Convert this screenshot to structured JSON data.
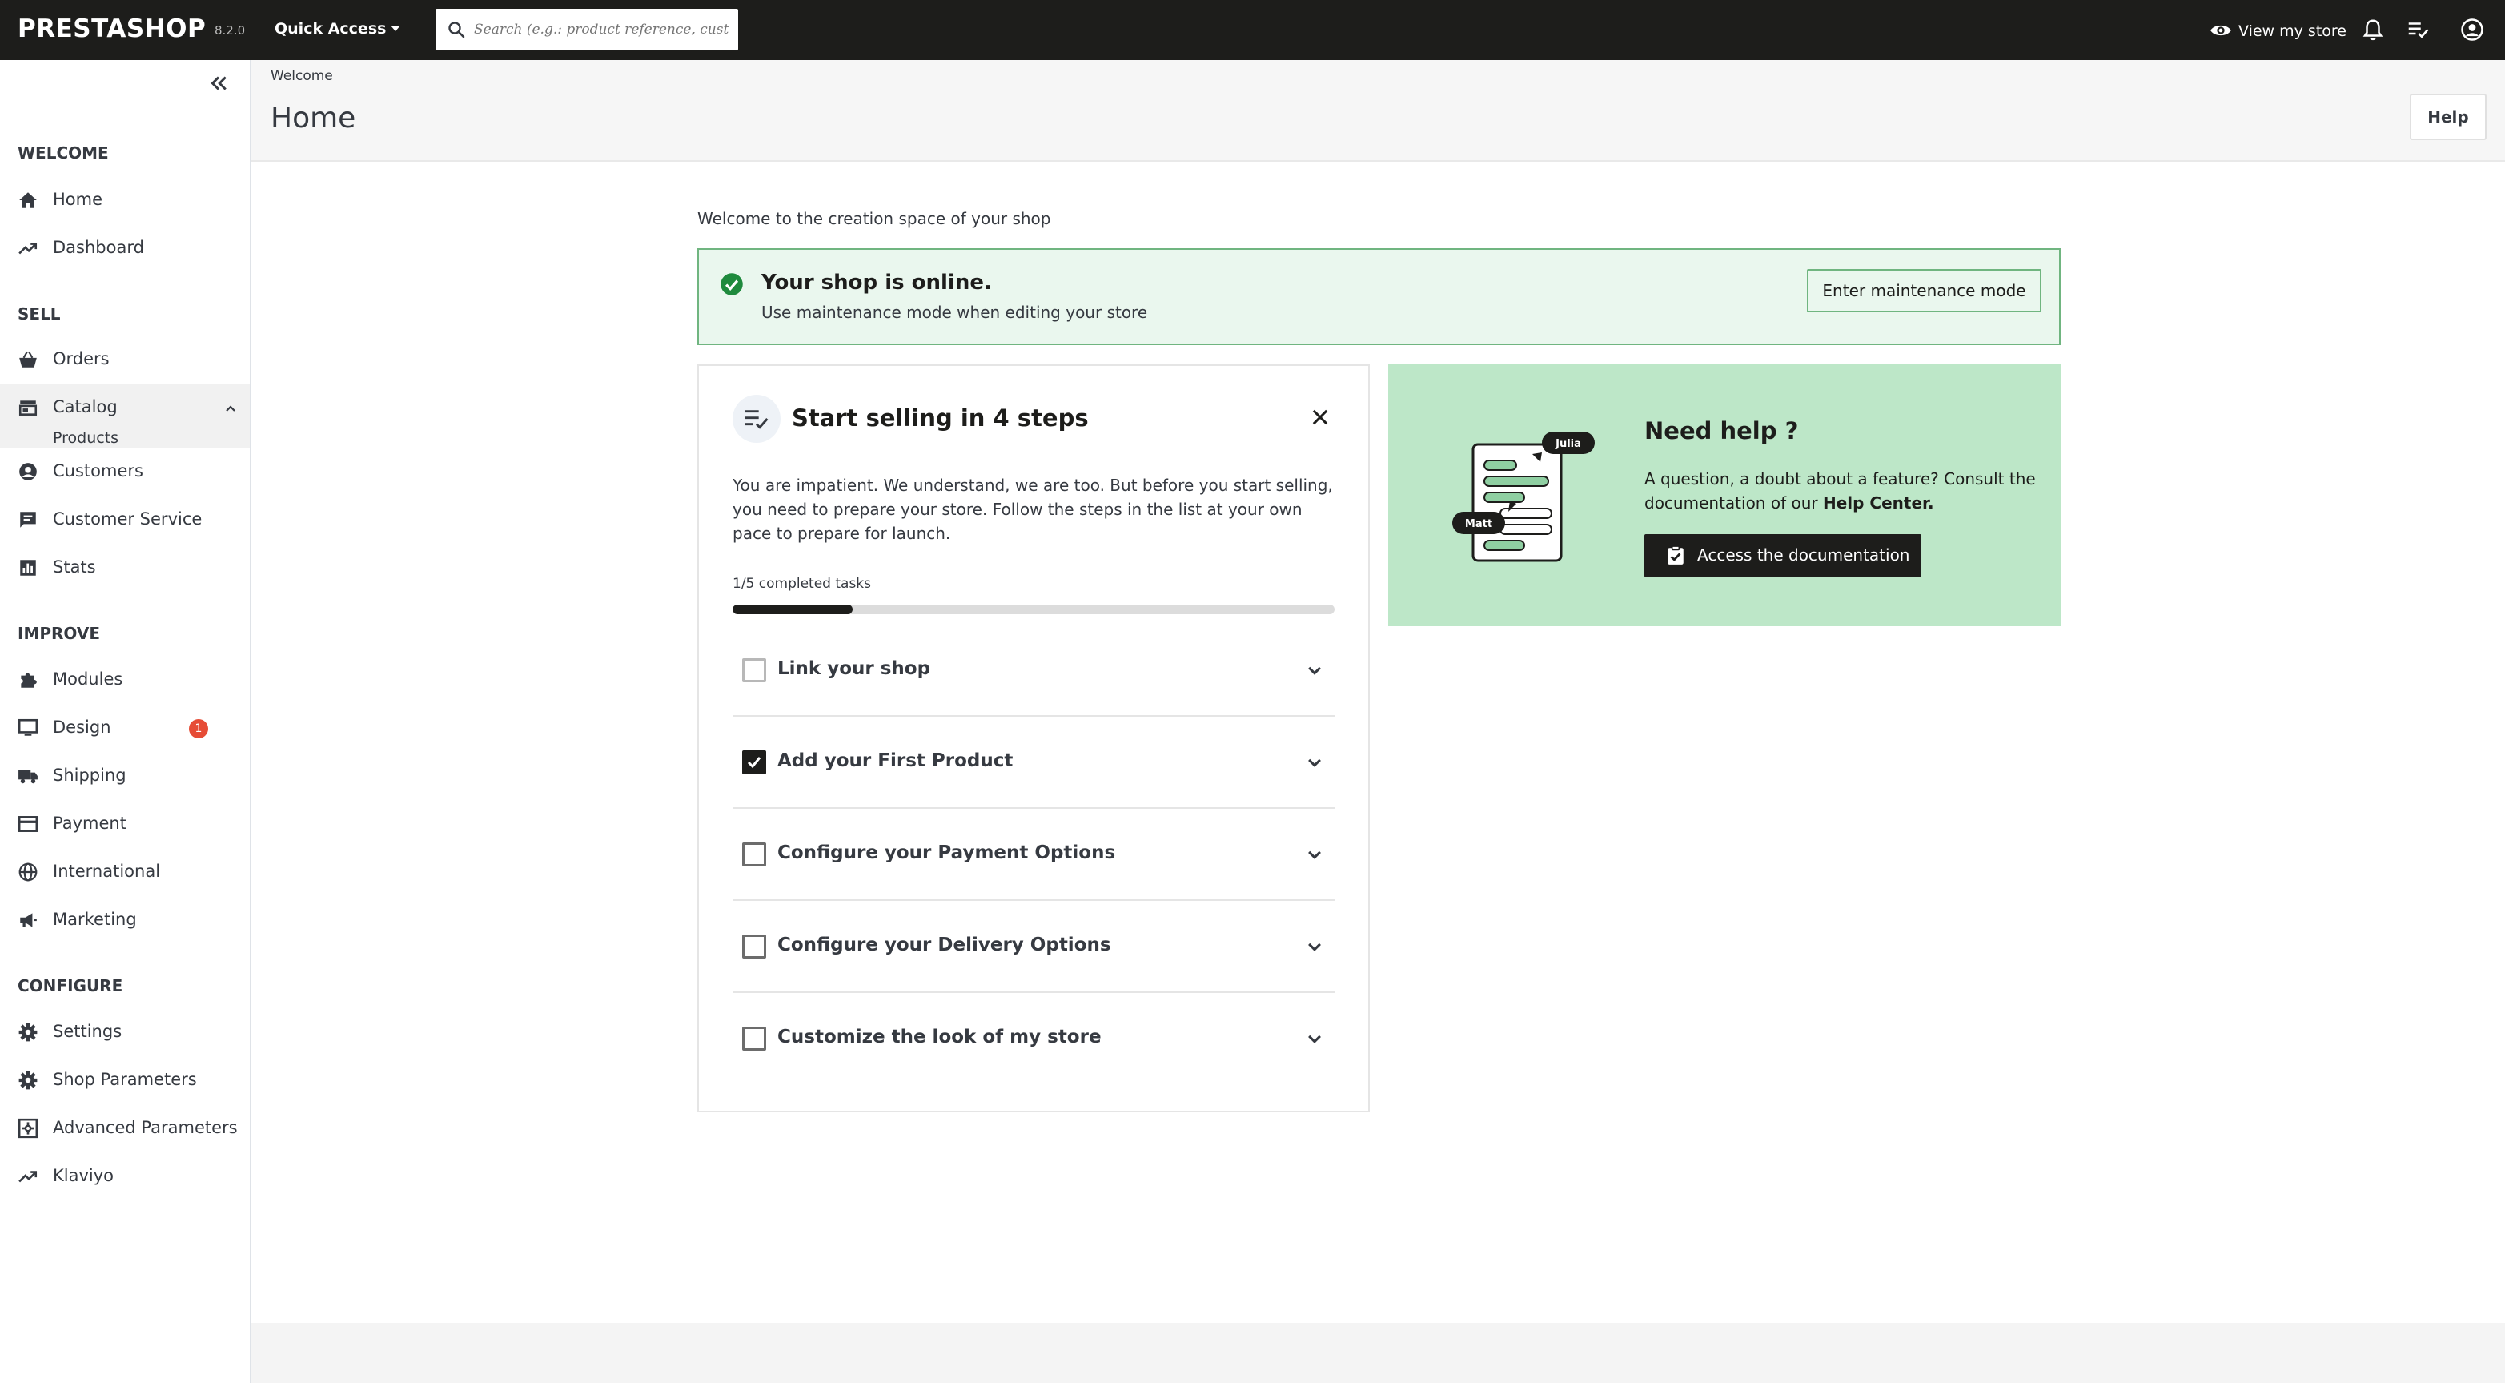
{
  "topbar": {
    "logo": "PRESTASHOP",
    "version": "8.2.0",
    "quick_access": "Quick Access",
    "search_placeholder": "Search (e.g.: product reference, custon",
    "view_store": "View my store"
  },
  "sidebar": {
    "sections": {
      "welcome": "WELCOME",
      "sell": "SELL",
      "improve": "IMPROVE",
      "configure": "CONFIGURE"
    },
    "items": {
      "home": "Home",
      "dashboard": "Dashboard",
      "orders": "Orders",
      "catalog": "Catalog",
      "products": "Products",
      "customers": "Customers",
      "customer_service": "Customer Service",
      "stats": "Stats",
      "modules": "Modules",
      "design": "Design",
      "shipping": "Shipping",
      "payment": "Payment",
      "international": "International",
      "marketing": "Marketing",
      "settings": "Settings",
      "shop_parameters": "Shop Parameters",
      "advanced_parameters": "Advanced Parameters",
      "klaviyo": "Klaviyo"
    },
    "design_badge": "1"
  },
  "header": {
    "breadcrumb": "Welcome",
    "title": "Home",
    "help_button": "Help"
  },
  "main": {
    "welcome_text": "Welcome to the creation space of your shop",
    "alert": {
      "title": "Your shop is online.",
      "text": "Use maintenance mode when editing your store",
      "button": "Enter maintenance mode"
    },
    "steps": {
      "title": "Start selling in 4 steps",
      "description": "You are impatient. We understand, we are too. But before you start selling, you need to prepare your store. Follow the steps in the list at your own pace to prepare for launch.",
      "progress_label": "1/5 completed tasks",
      "progress_fraction": 0.2,
      "tasks": [
        {
          "label": "Link your shop",
          "done": false
        },
        {
          "label": "Add your First Product",
          "done": true
        },
        {
          "label": "Configure your Payment Options",
          "done": false
        },
        {
          "label": "Configure your Delivery Options",
          "done": false
        },
        {
          "label": "Customize the look of my store",
          "done": false
        }
      ]
    },
    "help": {
      "title": "Need help ?",
      "text_prefix": "A question, a doubt about a feature? Consult the documentation of our ",
      "text_link": "Help Center.",
      "button": "Access the documentation",
      "bubble_julia": "Julia",
      "bubble_matt": "Matt"
    }
  },
  "colors": {
    "topbar_bg": "#1d1d1b",
    "alert_bg": "#eaf7ee",
    "alert_border": "#70b580",
    "help_card_bg": "#bde7c8",
    "badge_red": "#e64c36"
  }
}
